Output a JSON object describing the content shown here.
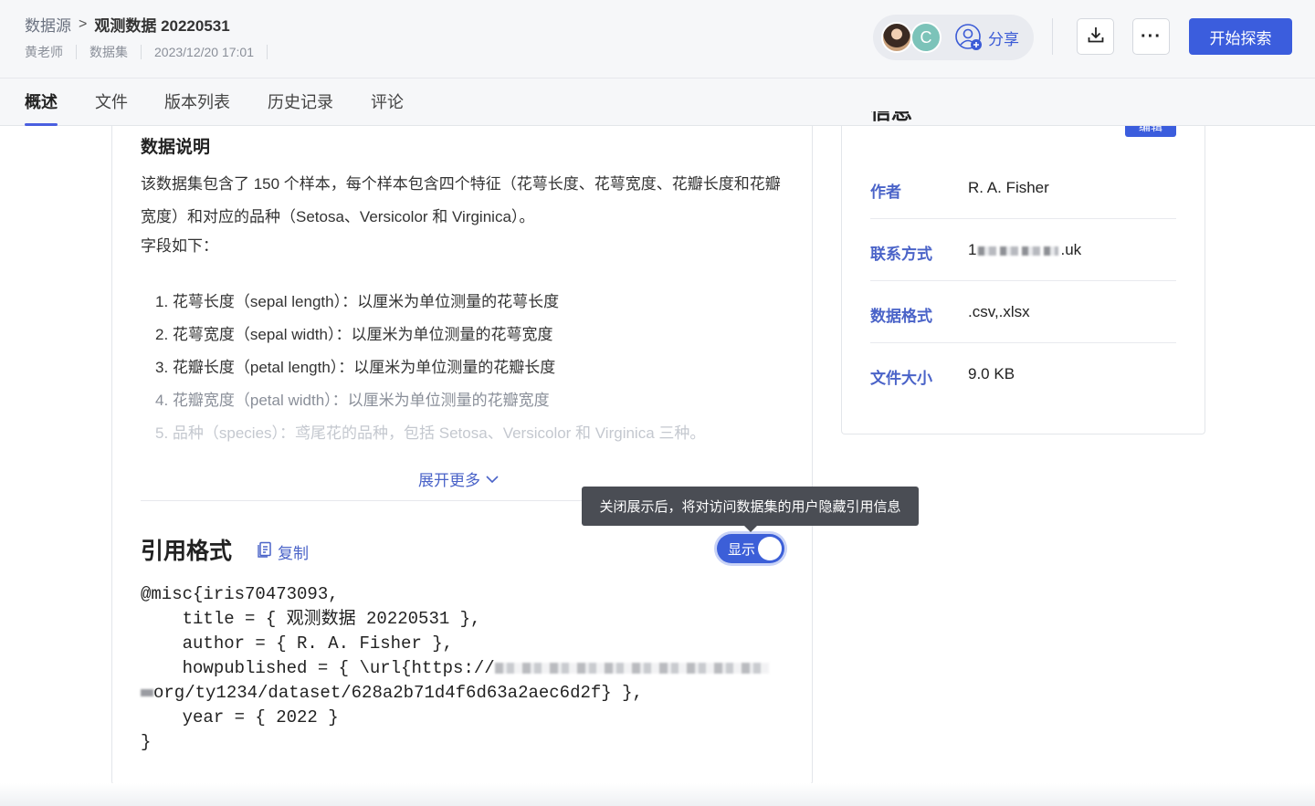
{
  "header": {
    "breadcrumb_root": "数据源",
    "breadcrumb_sep": ">",
    "title": "观测数据 20220531",
    "owner": "黄老师",
    "type": "数据集",
    "updated": "2023/12/20 17:01",
    "avatar_letter": "C",
    "share_label": "分享",
    "more_label": "···",
    "primary_label": "开始探索"
  },
  "tabs": [
    {
      "label": "概述",
      "active": true
    },
    {
      "label": "文件"
    },
    {
      "label": "版本列表"
    },
    {
      "label": "历史记录"
    },
    {
      "label": "评论"
    }
  ],
  "description": {
    "heading": "数据说明",
    "paragraph": "该数据集包含了 150 个样本，每个样本包含四个特征（花萼长度、花萼宽度、花瓣长度和花瓣宽度）和对应的品种（Setosa、Versicolor 和 Virginica）。",
    "fields_label": "字段如下：",
    "fields": [
      "1. 花萼长度（sepal length）：以厘米为单位测量的花萼长度",
      "2. 花萼宽度（sepal width）：以厘米为单位测量的花萼宽度",
      "3. 花瓣长度（petal length）：以厘米为单位测量的花瓣长度",
      "4. 花瓣宽度（petal width）：以厘米为单位测量的花瓣宽度",
      "5. 品种（species）：鸢尾花的品种，包括 Setosa、Versicolor 和 Virginica 三种。"
    ],
    "expand_label": "展开更多"
  },
  "citation": {
    "heading": "引用格式",
    "copy_label": "复制",
    "toggle_label": "显示",
    "toggle_on": true,
    "tooltip": "关闭展示后，将对访问数据集的用户隐藏引用信息",
    "line1": "@misc{iris70473093,",
    "line2": "    title = { 观测数据 20220531 },",
    "line3": "    author = { R. A. Fisher },",
    "line4_prefix": "    howpublished = { \\url{https://",
    "line5_suffix": "org/ty1234/dataset/628a2b71d4f6d63a2aec6d2f} },",
    "line6": "    year = { 2022 }",
    "line7": "}"
  },
  "info": {
    "title": "信息",
    "edit_label": "编辑",
    "rows": [
      {
        "key": "作者",
        "value": "R. A. Fisher"
      },
      {
        "key": "联系方式",
        "value_prefix": "1",
        "value_suffix": ".uk"
      },
      {
        "key": "数据格式",
        "value": ".csv,.xlsx"
      },
      {
        "key": "文件大小",
        "value": "9.0 KB"
      }
    ]
  },
  "colors": {
    "accent": "#3b5ddd",
    "link": "#4a63c8",
    "tooltip_bg": "#4a4d54"
  }
}
